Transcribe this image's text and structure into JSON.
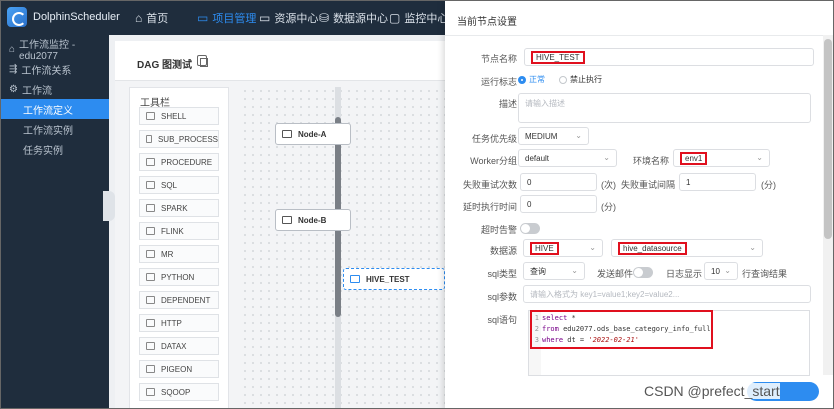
{
  "app": {
    "name": "DolphinScheduler"
  },
  "topnav": {
    "items": [
      {
        "label": "首页",
        "icon": "home-icon"
      },
      {
        "label": "项目管理",
        "icon": "folder-icon",
        "active": true
      },
      {
        "label": "资源中心",
        "icon": "folder-icon"
      },
      {
        "label": "数据源中心",
        "icon": "database-icon"
      },
      {
        "label": "监控中心",
        "icon": "monitor-icon"
      }
    ]
  },
  "sidebar": {
    "items": [
      {
        "label": "工作流监控 - edu2077",
        "icon": "home-icon"
      },
      {
        "label": "工作流关系",
        "icon": "relation-icon"
      },
      {
        "label": "工作流",
        "icon": "gear-icon"
      },
      {
        "label": "工作流定义",
        "active": true
      },
      {
        "label": "工作流实例"
      },
      {
        "label": "任务实例"
      }
    ]
  },
  "dag": {
    "title": "DAG 图测试",
    "toolbox_title": "工具栏",
    "tools": [
      "SHELL",
      "SUB_PROCESS",
      "PROCEDURE",
      "SQL",
      "SPARK",
      "FLINK",
      "MR",
      "PYTHON",
      "DEPENDENT",
      "HTTP",
      "DATAX",
      "PIGEON",
      "SQOOP"
    ],
    "nodes": [
      "Node-A",
      "Node-B",
      "HIVE_TEST"
    ]
  },
  "drawer": {
    "title": "当前节点设置",
    "fields": {
      "node_name": {
        "label": "节点名称",
        "value": "HIVE_TEST"
      },
      "run_flag": {
        "label": "运行标志",
        "options": [
          "正常",
          "禁止执行"
        ],
        "selected": "正常"
      },
      "description": {
        "label": "描述",
        "placeholder": "请输入描述"
      },
      "priority": {
        "label": "任务优先级",
        "value": "MEDIUM"
      },
      "worker_group": {
        "label": "Worker分组",
        "value": "default"
      },
      "env": {
        "label": "环境名称",
        "value": "env1"
      },
      "retry_times": {
        "label": "失败重试次数",
        "value": "0",
        "unit": "(次)"
      },
      "retry_interval": {
        "label": "失败重试间隔",
        "value": "1",
        "unit": "(分)"
      },
      "delay_time": {
        "label": "延时执行时间",
        "value": "0",
        "unit": "(分)"
      },
      "timeout_alarm": {
        "label": "超时告警"
      },
      "datasource": {
        "label": "数据源",
        "type": "HIVE",
        "name": "hive_datasource"
      },
      "sql_type": {
        "label": "sql类型",
        "value": "查询",
        "send_mail_label": "发送邮件",
        "log_label": "日志显示",
        "log_value": "10",
        "log_suffix": "行查询结果"
      },
      "sql_params": {
        "label": "sql参数",
        "placeholder": "请输入格式为 key1=value1;key2=value2..."
      },
      "sql": {
        "label": "sql语句",
        "lines": [
          {
            "no": "1",
            "kw": "select",
            "rest": " *"
          },
          {
            "no": "2",
            "kw": "from",
            "rest": " edu2077.ods_base_category_info_full"
          },
          {
            "no": "3",
            "kw": "where",
            "rest": " dt = ",
            "str": "'2022-02-21'"
          }
        ]
      }
    }
  },
  "watermark": "CSDN @prefect_start"
}
